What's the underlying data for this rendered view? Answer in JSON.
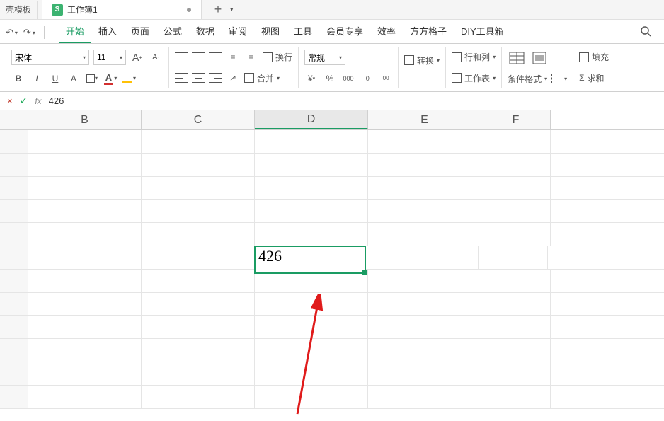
{
  "tabs": {
    "partial": "壳模板",
    "active_icon": "S",
    "active_name": "工作簿1",
    "add": "+"
  },
  "quick_access": {
    "undo": "↶",
    "redo": "↷"
  },
  "menu": {
    "items": [
      "开始",
      "插入",
      "页面",
      "公式",
      "数据",
      "审阅",
      "视图",
      "工具",
      "会员专享",
      "效率",
      "方方格子",
      "DIY工具箱"
    ],
    "active_index": 0
  },
  "ribbon": {
    "font_name": "宋体",
    "font_size": "11",
    "inc_font": "A",
    "dec_font": "A",
    "bold": "B",
    "italic": "I",
    "underline": "U",
    "strike": "A",
    "font_color": "A",
    "wrap_label": "换行",
    "merge_label": "合并",
    "number_format": "常规",
    "currency": "¥",
    "percent": "%",
    "thousand": "000",
    "dec_inc": ".0",
    "dec_dec": ".00",
    "convert_label": "转换",
    "rowcol_label": "行和列",
    "sheet_label": "工作表",
    "cond_format": "条件格式",
    "fill_label": "填充",
    "sum_label": "求和"
  },
  "formula_bar": {
    "cancel": "×",
    "accept": "✓",
    "fx": "fx",
    "value": "426"
  },
  "grid": {
    "columns": [
      "B",
      "C",
      "D",
      "E",
      "F"
    ],
    "active_col_index": 2,
    "rows": 12,
    "editing_cell": {
      "row": 5,
      "col": 2,
      "value": "426"
    }
  }
}
